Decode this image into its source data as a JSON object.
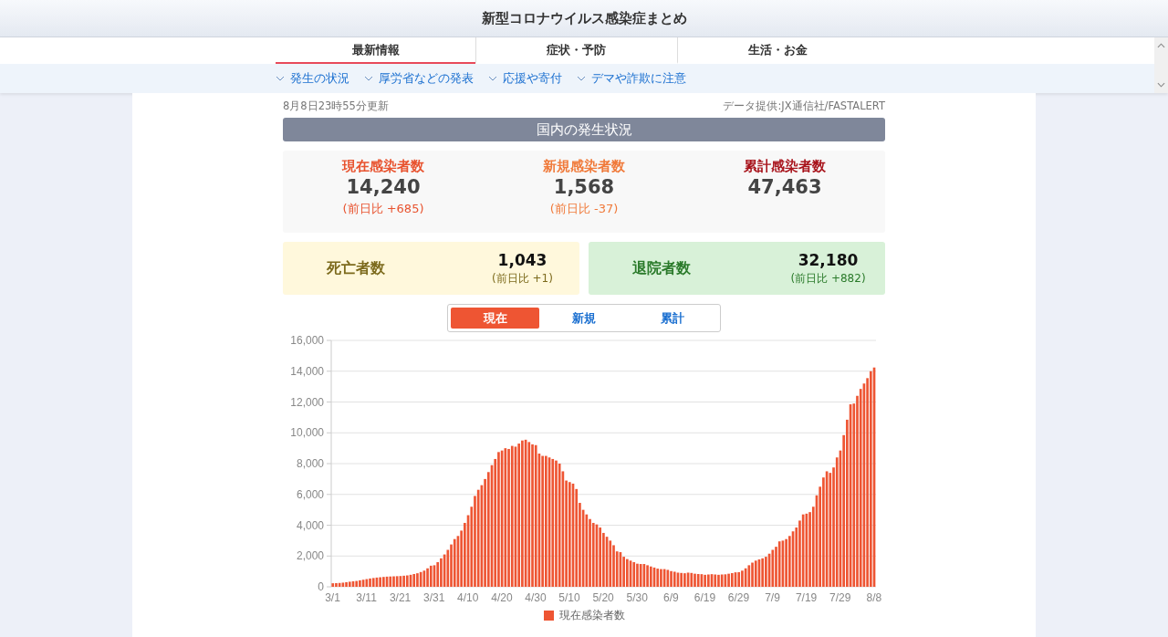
{
  "header": {
    "title": "新型コロナウイルス感染症まとめ"
  },
  "nav": {
    "tabs": [
      {
        "label": "最新情報",
        "selected": true
      },
      {
        "label": "症状・予防",
        "selected": false
      },
      {
        "label": "生活・お金",
        "selected": false
      }
    ],
    "links": [
      "発生の状況",
      "厚労省などの発表",
      "応援や寄付",
      "デマや詐欺に注意"
    ]
  },
  "updated": "8月8日23時55分更新",
  "source": "データ提供:JX通信社/FASTALERT",
  "section_title": "国内の発生状況",
  "summary": [
    {
      "label": "現在感染者数",
      "value": "14,240",
      "diff": "(前日比 +685)",
      "color": "#e8532f"
    },
    {
      "label": "新規感染者数",
      "value": "1,568",
      "diff": "(前日比 -37)",
      "color": "#f07a3a"
    },
    {
      "label": "累計感染者数",
      "value": "47,463",
      "color": "#a8141c"
    }
  ],
  "outcomes": [
    {
      "kind": "death",
      "label": "死亡者数",
      "value": "1,043",
      "diff": "(前日比 +1)"
    },
    {
      "kind": "recovered",
      "label": "退院者数",
      "value": "32,180",
      "diff": "(前日比 +882)"
    }
  ],
  "chart_tabs": [
    {
      "label": "現在",
      "selected": true
    },
    {
      "label": "新規",
      "selected": false
    },
    {
      "label": "累計",
      "selected": false
    }
  ],
  "chart_data": {
    "type": "bar",
    "grid": true,
    "ylim": [
      0,
      16000
    ],
    "yticks": [
      {
        "value": 0,
        "label": "0"
      },
      {
        "value": 2000,
        "label": "2,000"
      },
      {
        "value": 4000,
        "label": "4,000"
      },
      {
        "value": 6000,
        "label": "6,000"
      },
      {
        "value": 8000,
        "label": "8,000"
      },
      {
        "value": 10000,
        "label": "10,000"
      },
      {
        "value": 12000,
        "label": "12,000"
      },
      {
        "value": 14000,
        "label": "14,000"
      },
      {
        "value": 16000,
        "label": "16,000"
      }
    ],
    "categories": [
      "3/1",
      null,
      null,
      null,
      null,
      null,
      null,
      null,
      null,
      null,
      "3/11",
      null,
      null,
      null,
      null,
      null,
      null,
      null,
      null,
      null,
      "3/21",
      null,
      null,
      null,
      null,
      null,
      null,
      null,
      null,
      null,
      "3/31",
      null,
      null,
      null,
      null,
      null,
      null,
      null,
      null,
      null,
      "4/10",
      null,
      null,
      null,
      null,
      null,
      null,
      null,
      null,
      null,
      "4/20",
      null,
      null,
      null,
      null,
      null,
      null,
      null,
      null,
      null,
      "4/30",
      null,
      null,
      null,
      null,
      null,
      null,
      null,
      null,
      null,
      "5/10",
      null,
      null,
      null,
      null,
      null,
      null,
      null,
      null,
      null,
      "5/20",
      null,
      null,
      null,
      null,
      null,
      null,
      null,
      null,
      null,
      "5/30",
      null,
      null,
      null,
      null,
      null,
      null,
      null,
      null,
      null,
      "6/9",
      null,
      null,
      null,
      null,
      null,
      null,
      null,
      null,
      null,
      "6/19",
      null,
      null,
      null,
      null,
      null,
      null,
      null,
      null,
      null,
      "6/29",
      null,
      null,
      null,
      null,
      null,
      null,
      null,
      null,
      null,
      "7/9",
      null,
      null,
      null,
      null,
      null,
      null,
      null,
      null,
      null,
      "7/19",
      null,
      null,
      null,
      null,
      null,
      null,
      null,
      null,
      null,
      "7/29",
      null,
      null,
      null,
      null,
      null,
      null,
      null,
      null,
      null,
      "8/8"
    ],
    "series": [
      {
        "name": "現在感染者数",
        "color": "#ee5533",
        "values": [
          230,
          240,
          250,
          270,
          300,
          330,
          360,
          380,
          420,
          460,
          500,
          540,
          570,
          600,
          620,
          640,
          660,
          670,
          680,
          690,
          700,
          720,
          740,
          780,
          830,
          880,
          960,
          1050,
          1200,
          1370,
          1400,
          1600,
          1850,
          2100,
          2400,
          2750,
          3100,
          3300,
          3650,
          4150,
          4650,
          5200,
          5900,
          6300,
          6600,
          7000,
          7450,
          7900,
          8300,
          8750,
          8850,
          9000,
          8950,
          9150,
          9100,
          9300,
          9500,
          9550,
          9400,
          9250,
          9200,
          8650,
          8500,
          8500,
          8400,
          8300,
          8200,
          8000,
          7500,
          6900,
          6800,
          6700,
          6350,
          5450,
          5000,
          4700,
          4400,
          4150,
          4050,
          3850,
          3500,
          3250,
          3000,
          2700,
          2300,
          2250,
          1950,
          1800,
          1700,
          1600,
          1500,
          1480,
          1480,
          1400,
          1320,
          1250,
          1180,
          1150,
          1150,
          1100,
          1020,
          980,
          920,
          900,
          880,
          920,
          900,
          850,
          830,
          820,
          780,
          800,
          820,
          800,
          780,
          800,
          810,
          850,
          890,
          940,
          950,
          1050,
          1200,
          1400,
          1570,
          1700,
          1780,
          1850,
          1950,
          2150,
          2400,
          2600,
          2950,
          3000,
          3100,
          3300,
          3600,
          3850,
          4300,
          4700,
          4750,
          4850,
          5200,
          5940,
          6500,
          7100,
          7500,
          7400,
          7750,
          8400,
          8850,
          9850,
          10850,
          11850,
          11900,
          12400,
          12850,
          13200,
          13550,
          14000,
          14240
        ]
      }
    ]
  }
}
